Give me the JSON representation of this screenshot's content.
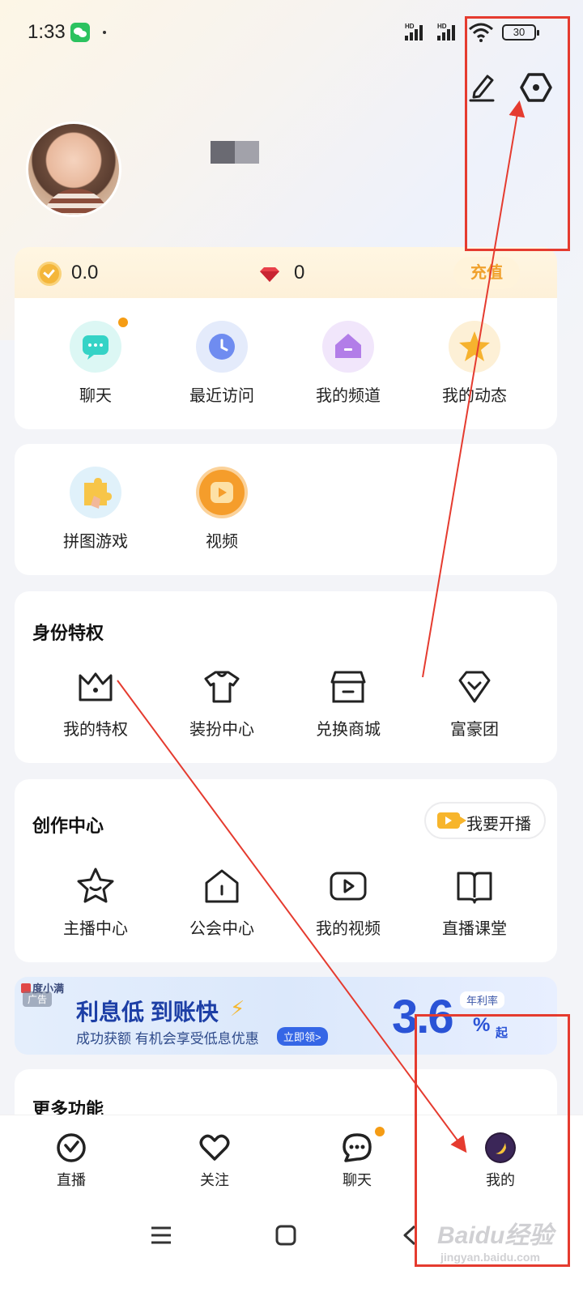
{
  "status_bar": {
    "time": "1:33",
    "signal_1": "HD",
    "signal_2": "HD",
    "battery": "30"
  },
  "header": {
    "edit_icon": "pencil-icon",
    "settings_icon": "hexagon-gear-icon"
  },
  "wallet": {
    "coin_value": "0.0",
    "diamond_value": "0",
    "recharge_label": "充值"
  },
  "quick_actions": [
    {
      "label": "聊天",
      "icon": "chat-bubble-icon",
      "color": "#35d3c6",
      "has_dot": true
    },
    {
      "label": "最近访问",
      "icon": "clock-icon",
      "color": "#6f8cf0"
    },
    {
      "label": "我的频道",
      "icon": "house-channel-icon",
      "color": "#b27de8"
    },
    {
      "label": "我的动态",
      "icon": "star-icon",
      "color": "#f6b22e"
    }
  ],
  "games": [
    {
      "label": "拼图游戏",
      "icon": "puzzle-icon"
    },
    {
      "label": "视频",
      "icon": "video-play-icon"
    }
  ],
  "privileges": {
    "title": "身份特权",
    "items": [
      {
        "label": "我的特权",
        "icon": "crown-icon"
      },
      {
        "label": "装扮中心",
        "icon": "tshirt-icon"
      },
      {
        "label": "兑换商城",
        "icon": "store-icon"
      },
      {
        "label": "富豪团",
        "icon": "diamond-badge-icon"
      }
    ]
  },
  "creator": {
    "title": "创作中心",
    "live_button": "我要开播",
    "items": [
      {
        "label": "主播中心",
        "icon": "star-smile-icon"
      },
      {
        "label": "公会中心",
        "icon": "house-icon"
      },
      {
        "label": "我的视频",
        "icon": "play-box-icon"
      },
      {
        "label": "直播课堂",
        "icon": "book-icon"
      }
    ]
  },
  "ad": {
    "brand": "度小满",
    "tag": "广告",
    "headline": "利息低 到账快",
    "subline": "成功获额 有机会享受低息优惠",
    "cta": "立即领>",
    "rate_label": "年利率",
    "rate": "3.6",
    "rate_unit": "%",
    "rate_suffix": "起"
  },
  "more": {
    "title": "更多功能"
  },
  "tabbar": {
    "items": [
      {
        "label": "直播",
        "icon": "live-icon"
      },
      {
        "label": "关注",
        "icon": "heart-icon"
      },
      {
        "label": "聊天",
        "icon": "chat-icon",
        "has_dot": true
      },
      {
        "label": "我的",
        "icon": "profile-avatar-icon",
        "active": true
      }
    ]
  },
  "watermark": {
    "text": "Baidu经验",
    "sub": "jingyan.baidu.com"
  },
  "colors": {
    "accent_orange": "#f59c14",
    "annotation_red": "#e53b2f",
    "ad_blue": "#2a53d6"
  }
}
